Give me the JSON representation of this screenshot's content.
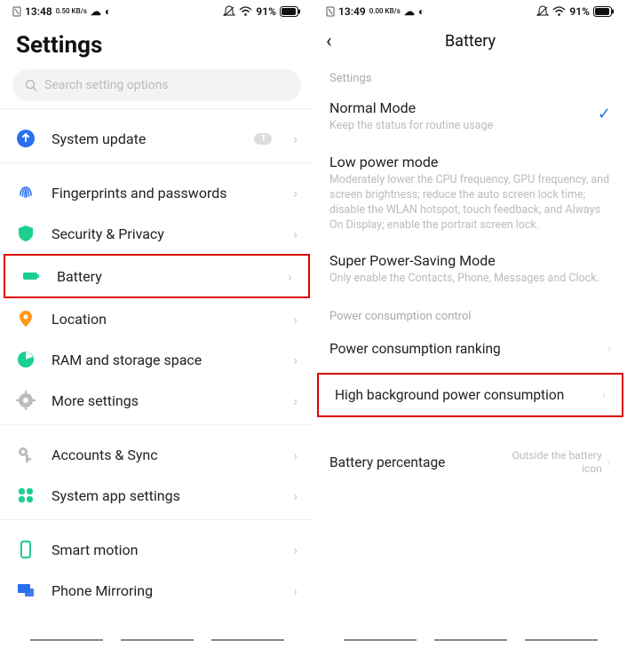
{
  "left": {
    "status": {
      "time": "13:48",
      "net": "0.50 KB/s",
      "battery_pct": "91%"
    },
    "title": "Settings",
    "search_placeholder": "Search setting options",
    "rows": {
      "system_update": "System update",
      "system_update_badge": "1",
      "fingerprints": "Fingerprints and passwords",
      "security": "Security & Privacy",
      "battery": "Battery",
      "location": "Location",
      "ram": "RAM and storage space",
      "more": "More settings",
      "accounts": "Accounts & Sync",
      "sysapp": "System app settings",
      "smart": "Smart motion",
      "mirror": "Phone Mirroring"
    }
  },
  "right": {
    "status": {
      "time": "13:49",
      "net": "0.00 KB/s",
      "battery_pct": "91%"
    },
    "title": "Battery",
    "section_settings": "Settings",
    "modes": {
      "normal": {
        "name": "Normal Mode",
        "desc": "Keep the status for routine usage"
      },
      "low": {
        "name": "Low power mode",
        "desc": "Moderately lower the CPU frequency, GPU frequency, and screen brightness; reduce the auto screen lock time; disable the WLAN hotspot, touch feedback, and Always On Display; enable the portrait screen lock."
      },
      "super": {
        "name": "Super Power-Saving Mode",
        "desc": "Only enable the Contacts, Phone, Messages and Clock."
      }
    },
    "section_pcc": "Power consumption control",
    "ranking": "Power consumption ranking",
    "highbg": "High background power consumption",
    "batpct": {
      "label": "Battery percentage",
      "value": "Outside the battery icon"
    }
  }
}
